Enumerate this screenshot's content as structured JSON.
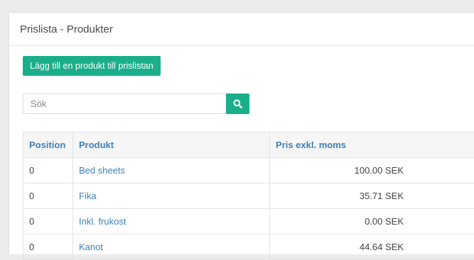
{
  "panel": {
    "title": "Prislista - Produkter"
  },
  "toolbar": {
    "add_label": "Lägg till en produkt till prislistan"
  },
  "search": {
    "placeholder": "Sök",
    "icon": "search-icon",
    "accent": "#1aae8a"
  },
  "table": {
    "headers": [
      "Position",
      "Produkt",
      "Pris exkl. moms"
    ],
    "rows": [
      {
        "position": "0",
        "product": "Bed sheets",
        "price": "100.00 SEK"
      },
      {
        "position": "0",
        "product": "Fika",
        "price": "35.71 SEK"
      },
      {
        "position": "0",
        "product": "Inkl. frukost",
        "price": "0.00 SEK"
      },
      {
        "position": "0",
        "product": "Kanot",
        "price": "44.64 SEK"
      }
    ]
  },
  "colors": {
    "accent": "#1aae8a",
    "link": "#3e80b8"
  }
}
